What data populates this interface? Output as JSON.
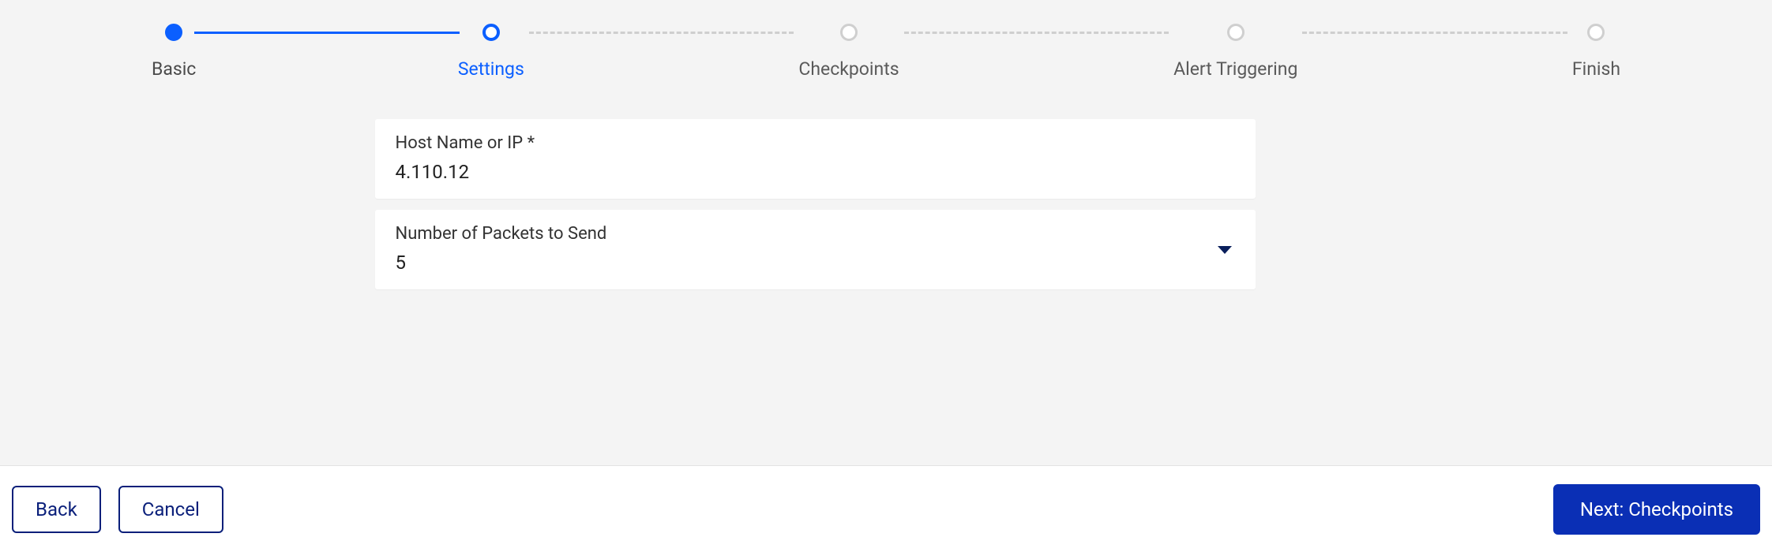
{
  "stepper": {
    "steps": [
      {
        "label": "Basic",
        "state": "done"
      },
      {
        "label": "Settings",
        "state": "current"
      },
      {
        "label": "Checkpoints",
        "state": "pending"
      },
      {
        "label": "Alert Triggering",
        "state": "pending"
      },
      {
        "label": "Finish",
        "state": "pending"
      }
    ]
  },
  "form": {
    "host": {
      "label": "Host Name or IP *",
      "value": "4.110.12"
    },
    "packets": {
      "label": "Number of Packets to Send",
      "value": "5"
    }
  },
  "footer": {
    "back": "Back",
    "cancel": "Cancel",
    "next": "Next: Checkpoints"
  }
}
